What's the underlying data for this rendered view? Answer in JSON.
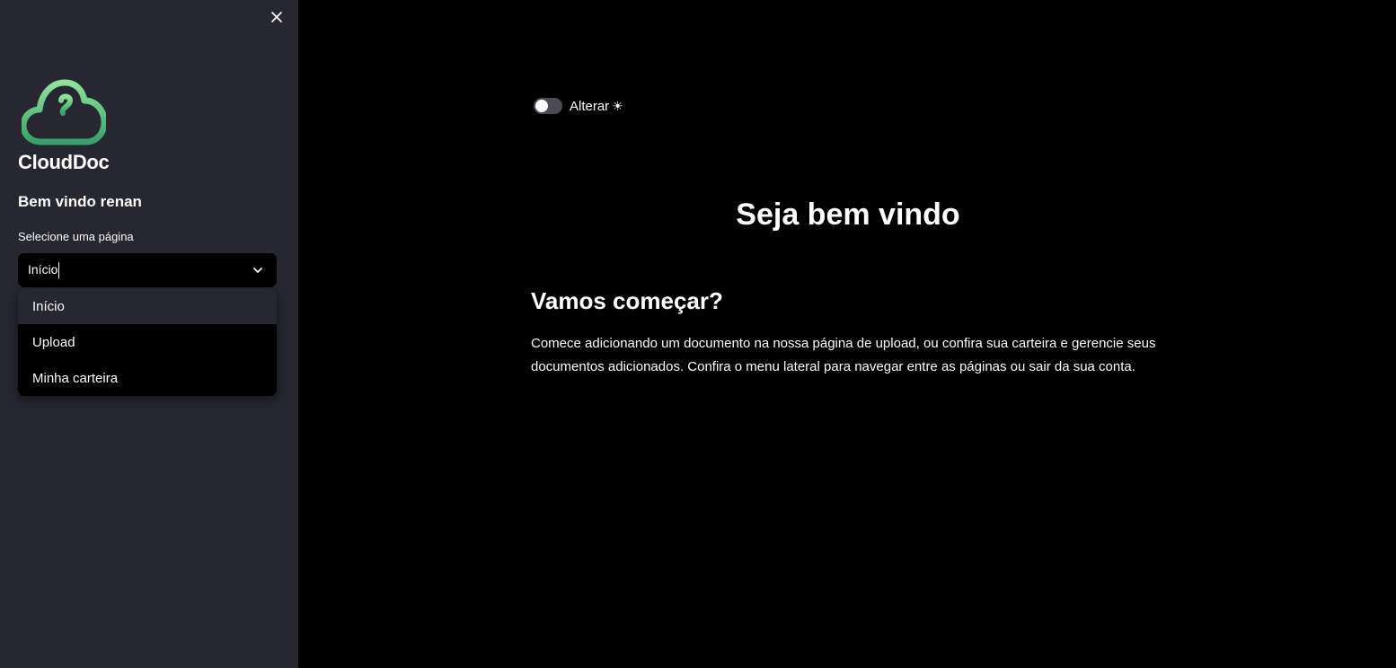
{
  "sidebar": {
    "close_icon": "close-icon",
    "logo": {
      "text": "CloudDoc",
      "icon": "cloud-icon",
      "gradient": [
        "#8fe39a",
        "#3aa06a"
      ]
    },
    "welcome": "Bem vindo renan",
    "select_label": "Selecione uma página",
    "select_value": "Início",
    "options": [
      "Início",
      "Upload",
      "Minha carteira"
    ]
  },
  "main": {
    "toggle_label": "Alterar",
    "toggle_icon": "☀",
    "title": "Seja bem vindo",
    "subtitle": "Vamos começar?",
    "paragraph": "Comece adicionando um documento na nossa página de upload, ou confira sua carteira e gerencie seus documentos adicionados. Confira o menu lateral para navegar entre as páginas ou sair da sua conta."
  },
  "colors": {
    "sidebar_bg": "#262730",
    "main_bg": "#000000",
    "text": "#fafafa"
  }
}
